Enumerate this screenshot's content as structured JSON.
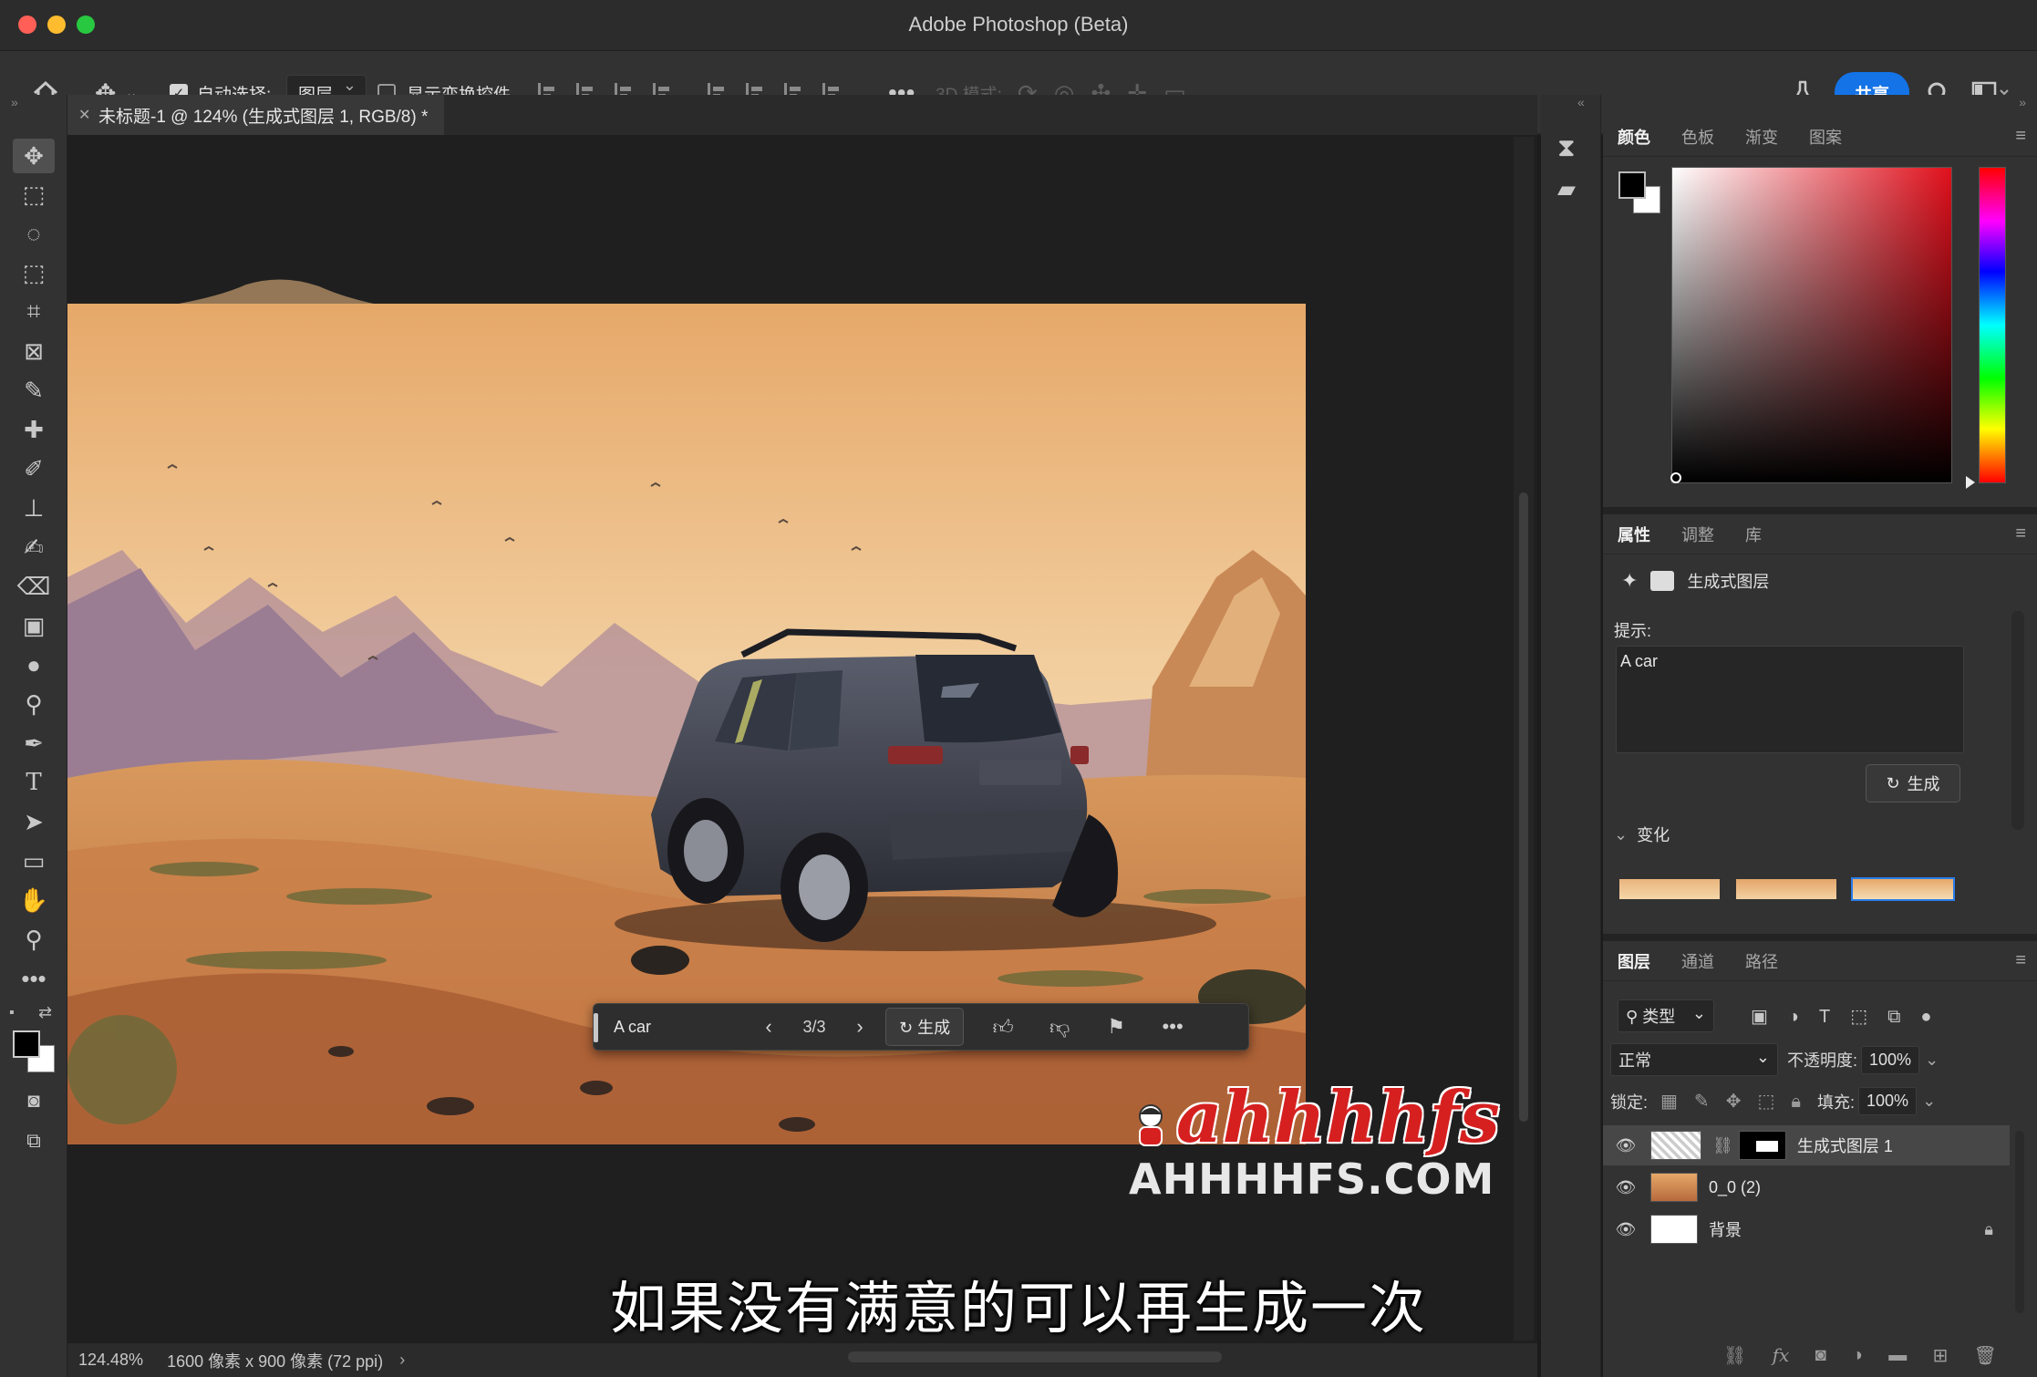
{
  "window": {
    "title": "Adobe Photoshop (Beta)"
  },
  "options_bar": {
    "auto_select_label": "自动选择:",
    "auto_select_target": "图层",
    "show_transform_label": "显示变换控件",
    "mode_3d_label": "3D 模式:",
    "share_label": "共享"
  },
  "document": {
    "tab_title": "未标题-1 @ 124% (生成式图层 1, RGB/8) *"
  },
  "contextual_bar": {
    "prompt": "A car",
    "counter": "3/3",
    "generate_label": "生成"
  },
  "status_bar": {
    "zoom": "124.48%",
    "doc_info": "1600 像素 x 900 像素 (72 ppi)"
  },
  "color_panel": {
    "tabs": [
      "颜色",
      "色板",
      "渐变",
      "图案"
    ],
    "foreground": "#000000",
    "background": "#ffffff"
  },
  "properties_panel": {
    "tabs": [
      "属性",
      "调整",
      "库"
    ],
    "layer_type": "生成式图层",
    "prompt_label": "提示:",
    "prompt_value": "A car",
    "generate_label": "生成",
    "variations_label": "变化"
  },
  "layers_panel": {
    "tabs": [
      "图层",
      "通道",
      "路径"
    ],
    "filter_kind": "类型",
    "blend_mode": "正常",
    "opacity_label": "不透明度:",
    "opacity_value": "100%",
    "lock_label": "锁定:",
    "fill_label": "填充:",
    "fill_value": "100%",
    "layers": [
      {
        "name": "生成式图层 1",
        "selected": true
      },
      {
        "name": "0_0 (2)",
        "selected": false
      },
      {
        "name": "背景",
        "selected": false,
        "locked": true
      }
    ]
  },
  "overlay": {
    "subtitle": "如果没有满意的可以再生成一次",
    "watermark_brand": "ahhhhfs",
    "watermark_url": "AHHHHFS.COM"
  },
  "colors": {
    "accent": "#1473e6",
    "selection_blue": "#2b7de9",
    "watermark_red": "#d62020"
  }
}
